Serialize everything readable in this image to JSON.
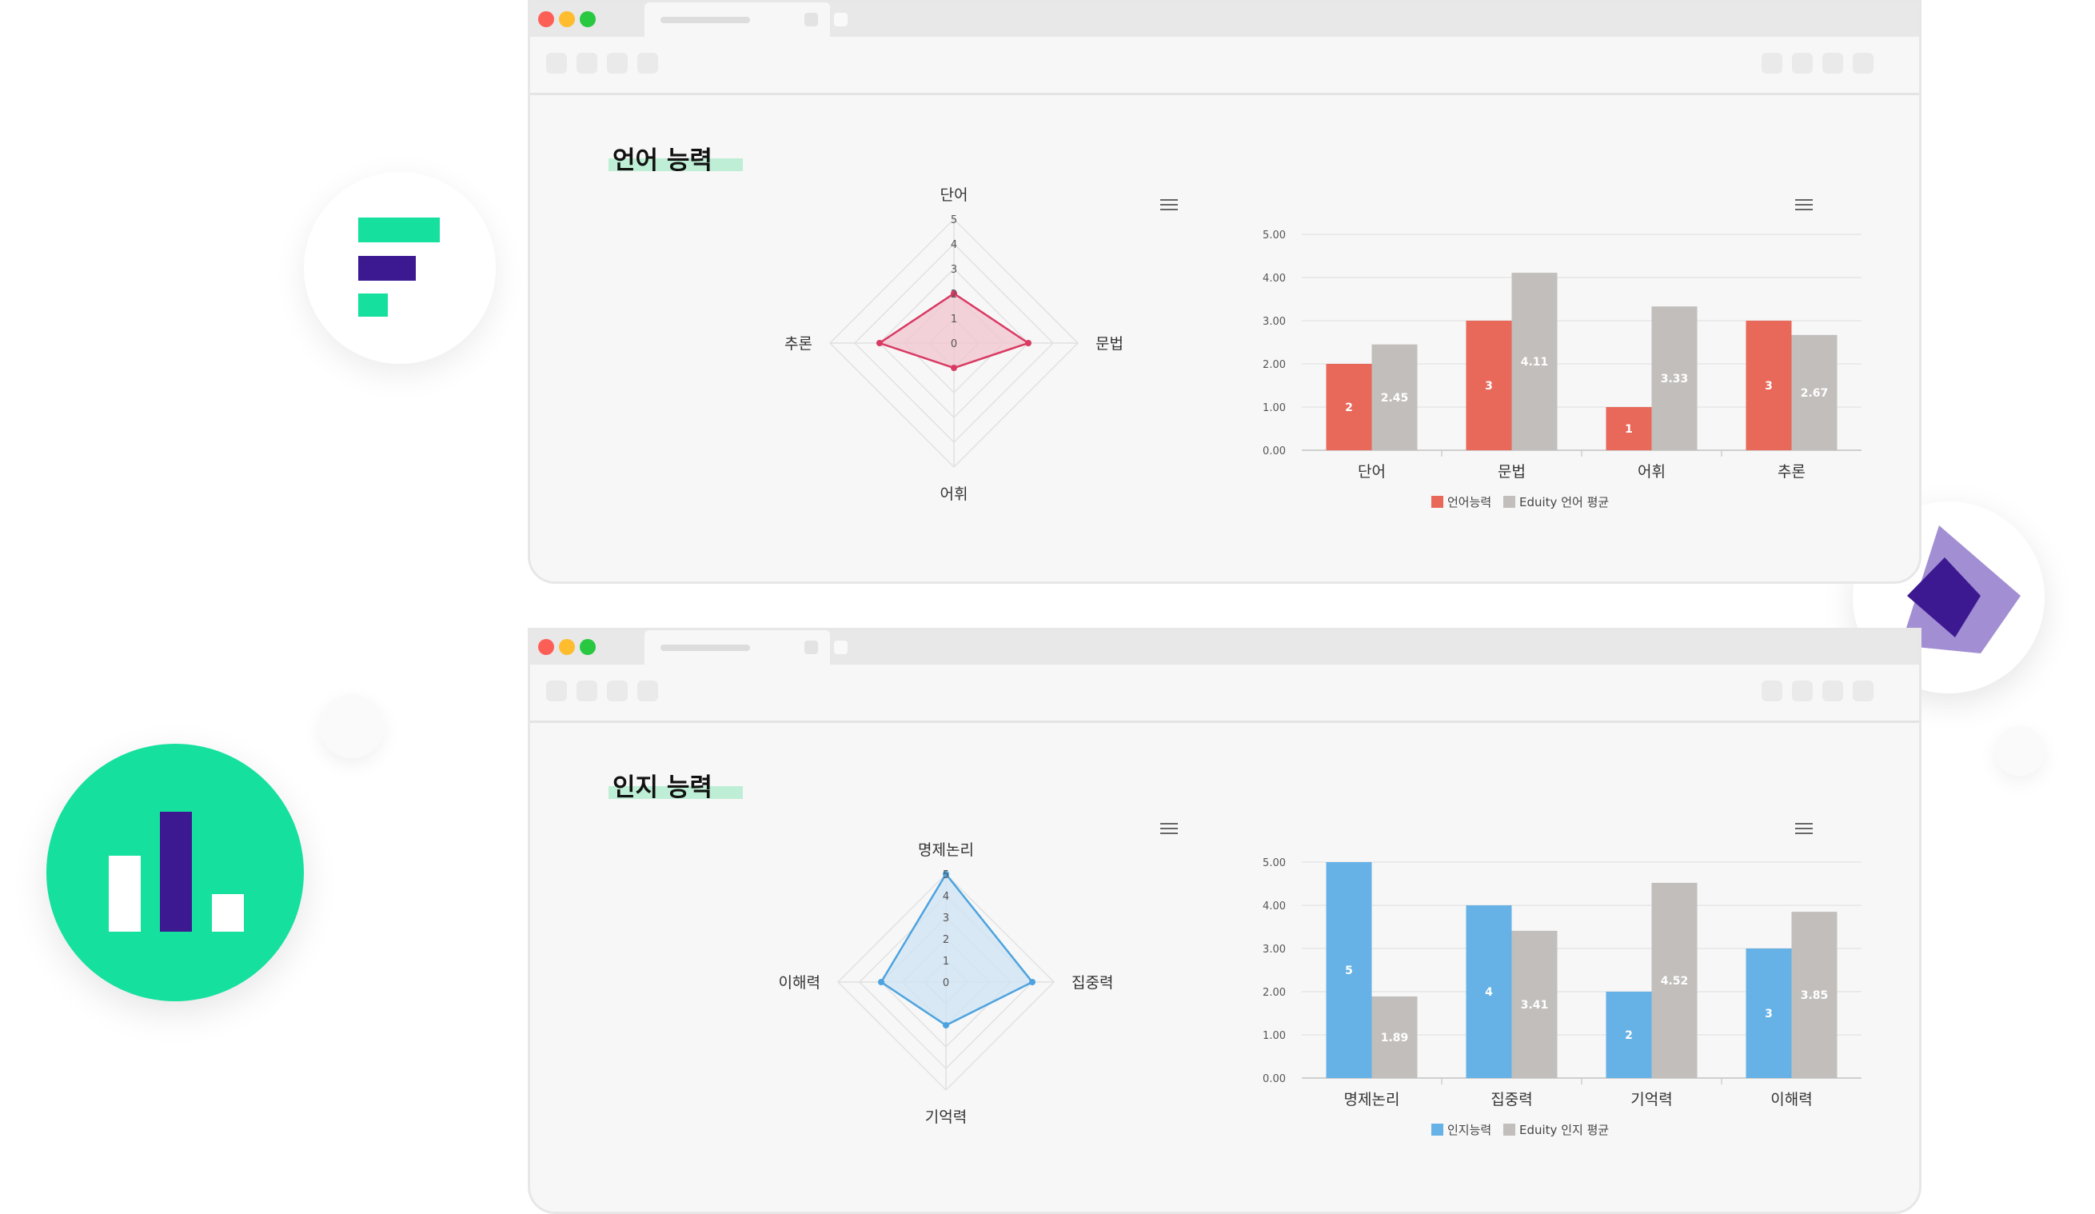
{
  "colors": {
    "language": "#e8685a",
    "cognitive": "#66b2e6",
    "average": "#c2bebc",
    "radar_language_stroke": "#d93a63",
    "radar_language_fill": "#f2c4cf",
    "radar_cognitive_stroke": "#4ca3df",
    "radar_cognitive_fill": "#cfe3f4",
    "brand_green": "#16e09e",
    "brand_purple": "#3d1991",
    "highlight": "#bfeed6"
  },
  "icons": [
    "brand-f-logo-icon",
    "bar-chart-logo-icon",
    "diamond-logo-icon",
    "hamburger-menu-icon"
  ],
  "language_section": {
    "title": "언어 능력",
    "radar": {
      "axes": [
        "단어",
        "문법",
        "어휘",
        "추론"
      ],
      "ticks": [
        "0",
        "1",
        "2",
        "3",
        "4",
        "5"
      ],
      "max": 5,
      "values": [
        2,
        3,
        1,
        3
      ]
    },
    "chart_data": {
      "type": "bar",
      "categories": [
        "단어",
        "문법",
        "어휘",
        "추론"
      ],
      "series": [
        {
          "name": "언어능력",
          "values": [
            2,
            3,
            1,
            3
          ],
          "labels": [
            "2",
            "3",
            "1",
            "3"
          ]
        },
        {
          "name": "Eduity 언어 평균",
          "values": [
            2.45,
            4.11,
            3.33,
            2.67
          ],
          "labels": [
            "2.45",
            "4.11",
            "3.33",
            "2.67"
          ]
        }
      ],
      "yticks": [
        "0.00",
        "1.00",
        "2.00",
        "3.00",
        "4.00",
        "5.00"
      ],
      "ylim": [
        0,
        5
      ],
      "legend_position": "bottom"
    }
  },
  "cognitive_section": {
    "title": "인지 능력",
    "radar": {
      "axes": [
        "명제논리",
        "집중력",
        "기억력",
        "이해력"
      ],
      "ticks": [
        "0",
        "1",
        "2",
        "3",
        "4",
        "5"
      ],
      "max": 5,
      "values": [
        5,
        4,
        2,
        3
      ]
    },
    "chart_data": {
      "type": "bar",
      "categories": [
        "명제논리",
        "집중력",
        "기억력",
        "이해력"
      ],
      "series": [
        {
          "name": "인지능력",
          "values": [
            5,
            4,
            2,
            3
          ],
          "labels": [
            "5",
            "4",
            "2",
            "3"
          ]
        },
        {
          "name": "Eduity 인지 평균",
          "values": [
            1.89,
            3.41,
            4.52,
            3.85
          ],
          "labels": [
            "1.89",
            "3.41",
            "4.52",
            "3.85"
          ]
        }
      ],
      "yticks": [
        "0.00",
        "1.00",
        "2.00",
        "3.00",
        "4.00",
        "5.00"
      ],
      "ylim": [
        0,
        5
      ],
      "legend_position": "bottom"
    }
  }
}
